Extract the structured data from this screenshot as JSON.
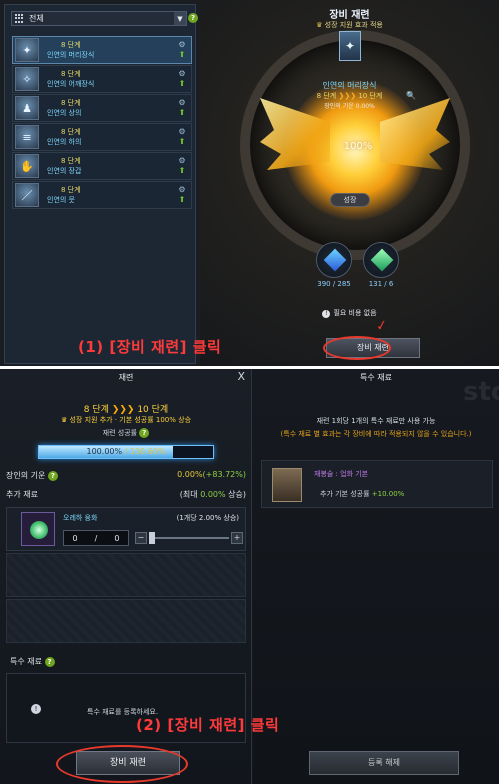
{
  "top": {
    "filter": {
      "label": "전체"
    },
    "items": [
      {
        "stage": "8 단계",
        "name": "인연의 머리장식",
        "icon": "✦",
        "selected": true
      },
      {
        "stage": "8 단계",
        "name": "인연의 어깨장식",
        "icon": "✧",
        "selected": false
      },
      {
        "stage": "8 단계",
        "name": "인연의 상의",
        "icon": "♟",
        "selected": false
      },
      {
        "stage": "8 단계",
        "name": "인연의 하의",
        "icon": "≡",
        "selected": false
      },
      {
        "stage": "8 단계",
        "name": "인연의 장갑",
        "icon": "✋",
        "selected": false
      },
      {
        "stage": "8 단계",
        "name": "인연의 뭇",
        "icon": "／",
        "selected": false
      }
    ],
    "panel": {
      "title": "장비 재련",
      "subtitle": "성장 지원 효과 적용",
      "item_name": "인연의 머리장식",
      "stage_from": "8 단계",
      "stage_to": "10 단계",
      "base_chance": "장인의 기운 0.00%",
      "progress_text": "100%",
      "grow_label": "성장",
      "mat1_count": "390 / 285",
      "mat2_count": "131 / 6",
      "cost_text": "필요 비용 없음",
      "refine_label": "장비 재련"
    },
    "annotation": "(1) [장비 재련] 클릭"
  },
  "bottom": {
    "left": {
      "title": "재련",
      "close": "X",
      "stage_from": "8 단계",
      "stage_to": "10 단계",
      "bonus": "성장 지원 추가 · 기본 성공률 100% 상승",
      "chance_label": "재련 성공률",
      "bar_text": "100.00%",
      "bar_text2": "/ 130.60%",
      "bar_fill": 0.77,
      "artisan_label": "장인의 기운",
      "artisan_value": "0.00%",
      "artisan_bonus": "(+83.72%)",
      "extra_label": "추가 재료",
      "extra_max": "(최대",
      "extra_max_val": "0.00%",
      "extra_max_end": "상승)",
      "material_name": "오레하 융화",
      "material_note": "(1개당 2.00% 상승)",
      "qty_current": "0",
      "qty_sep": "/",
      "qty_max": "0",
      "special_label": "특수 재료",
      "special_msg": "특수 재료를 등록하세요.",
      "refine_label": "장비 재련"
    },
    "right": {
      "title": "특수 재료",
      "line1": "재련 1회당 1개의 특수 재료만 사용 가능",
      "line2": "(특수 재료 별 효과는 각 장비에 따라 적용되지 않을 수 있습니다.)",
      "item_name": "재봉술 : 업화 기본",
      "item_desc": "추가 기본 성공률",
      "item_bonus": "+10.00%",
      "unregister_label": "등록 해제"
    },
    "annotation": "(2) [장비 재련] 클릭",
    "watermark": "story.com"
  },
  "colors": {
    "annotation": "#ff3a3a",
    "accent_blue": "#7fd8ff",
    "gold": "#ffd23a"
  }
}
